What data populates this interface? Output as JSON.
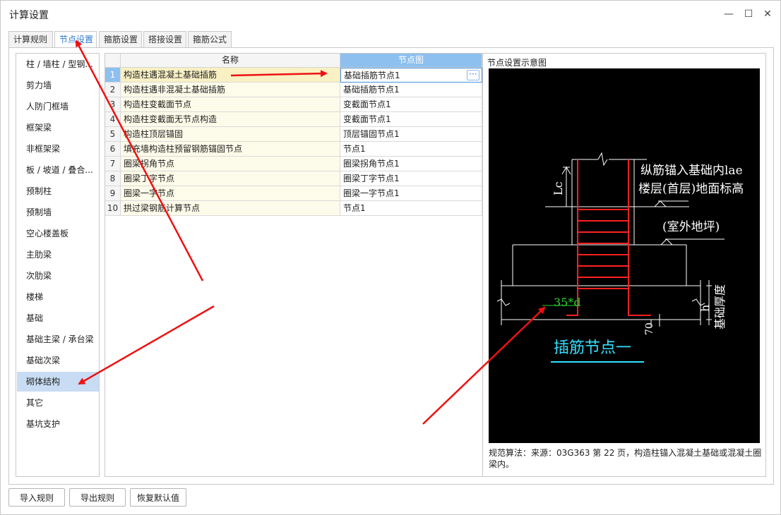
{
  "window": {
    "title": "计算设置",
    "min_glyph": "—",
    "max_glyph": "☐",
    "close_glyph": "✕"
  },
  "tabs": [
    "计算规则",
    "节点设置",
    "箍筋设置",
    "搭接设置",
    "箍筋公式"
  ],
  "active_tab": 1,
  "sidebar": {
    "items": [
      "柱 / 墙柱 / 型钢...",
      "剪力墙",
      "人防门框墙",
      "框架梁",
      "非框架梁",
      "板 / 坡道 / 叠合...",
      "预制柱",
      "预制墙",
      "空心楼盖板",
      "主肋梁",
      "次肋梁",
      "楼梯",
      "基础",
      "基础主梁 / 承台梁",
      "基础次梁",
      "砌体结构",
      "其它",
      "基坑支护"
    ],
    "selected": 15
  },
  "table": {
    "headers": {
      "index": "",
      "name": "名称",
      "node": "节点图"
    },
    "rows": [
      {
        "index": "1",
        "name": "构造柱遇混凝土基础插筋",
        "node": "基础插筋节点1"
      },
      {
        "index": "2",
        "name": "构造柱遇非混凝土基础插筋",
        "node": "基础插筋节点1"
      },
      {
        "index": "3",
        "name": "构造柱变截面节点",
        "node": "变截面节点1"
      },
      {
        "index": "4",
        "name": "构造柱变截面无节点构造",
        "node": "变截面节点1"
      },
      {
        "index": "5",
        "name": "构造柱顶层锚固",
        "node": "顶层锚固节点1"
      },
      {
        "index": "6",
        "name": "填充墙构造柱预留钢筋锚固节点",
        "node": "节点1"
      },
      {
        "index": "7",
        "name": "圈梁拐角节点",
        "node": "圈梁拐角节点1"
      },
      {
        "index": "8",
        "name": "圈梁丁字节点",
        "node": "圈梁丁字节点1"
      },
      {
        "index": "9",
        "name": "圈梁一字节点",
        "node": "圈梁一字节点1"
      },
      {
        "index": "10",
        "name": "拱过梁钢筋计算节点",
        "node": "节点1"
      }
    ],
    "selected_row": 0,
    "ellipsis_label": "···"
  },
  "diagram": {
    "label": "节点设置示意图",
    "texts": {
      "anchor": "纵筋锚入基础内lae",
      "floor": "楼层(首层)地面标高",
      "outdoor": "(室外地坪)",
      "lc": "Lc",
      "d35": "35*d",
      "h": "h",
      "thickness": "基础厚度",
      "seventy": "70",
      "node_title": "插筋节点一"
    },
    "description": "规范算法：来源：03G363 第 22 页，构造柱锚入混凝土基础或混凝土圈梁内。",
    "colors": {
      "rebar": "#ff2020",
      "lines": "#ffffff",
      "green": "#2ed12e",
      "cyan": "#33e0ff",
      "background": "#000000"
    }
  },
  "buttons": {
    "import": "导入规则",
    "export": "导出规则",
    "restore": "恢复默认值"
  },
  "annotations": {
    "arrow_color": "#ee1111"
  }
}
